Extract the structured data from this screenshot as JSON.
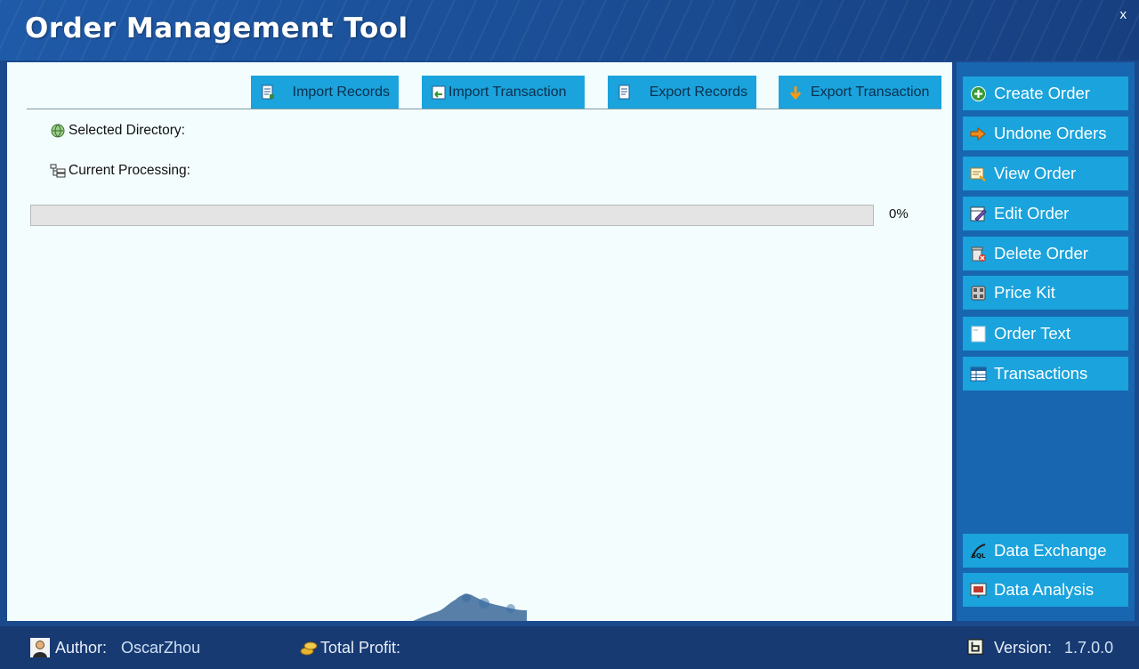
{
  "window": {
    "title": "Order Management Tool",
    "close_label": "x"
  },
  "toolbar": {
    "import_records": "Import Records",
    "import_transaction": "Import Transaction",
    "export_records": "Export Records",
    "export_transaction": "Export Transaction"
  },
  "panel": {
    "selected_directory_label": "Selected Directory:",
    "current_processing_label": "Current Processing:",
    "progress": {
      "percent": 0,
      "text": "0%"
    }
  },
  "sidebar": {
    "items": [
      {
        "label": "Create Order",
        "icon": "plus-circle-icon"
      },
      {
        "label": "Undone Orders",
        "icon": "arrow-right-icon"
      },
      {
        "label": "View Order",
        "icon": "view-doc-icon"
      },
      {
        "label": "Edit Order",
        "icon": "edit-icon"
      },
      {
        "label": "Delete Order",
        "icon": "trash-icon"
      },
      {
        "label": "Price Kit",
        "icon": "calculator-icon"
      },
      {
        "label": "Order Text",
        "icon": "text-doc-icon"
      },
      {
        "label": "Transactions",
        "icon": "table-icon"
      }
    ],
    "bottom_items": [
      {
        "label": "Data Exchange",
        "icon": "sql-icon"
      },
      {
        "label": "Data Analysis",
        "icon": "chart-icon"
      }
    ]
  },
  "status": {
    "author_label": "Author:",
    "author_value": "OscarZhou",
    "profit_label": "Total Profit:",
    "version_label": "Version:",
    "version_value": "1.7.0.0"
  },
  "colors": {
    "title_bar": "#1b4f97",
    "sidebar_bg": "#1866b0",
    "button_bg": "#1aa3dc",
    "panel_bg": "#f3fdfd",
    "status_bg": "#173a73"
  }
}
